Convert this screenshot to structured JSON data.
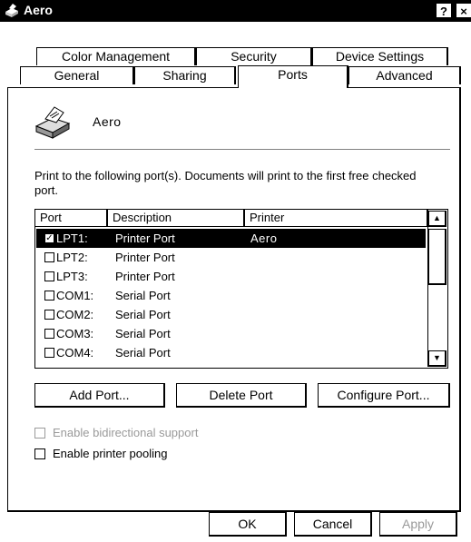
{
  "window": {
    "title": "Aero",
    "help_label": "?",
    "close_label": "×"
  },
  "tabs": {
    "row1": [
      "Color Management",
      "Security",
      "Device Settings"
    ],
    "row2": [
      "General",
      "Sharing",
      "Ports",
      "Advanced"
    ],
    "active": "Ports"
  },
  "printer": {
    "name": "Aero"
  },
  "description": "Print to the following port(s). Documents will print to the first free checked port.",
  "ports_list": {
    "columns": [
      "Port",
      "Description",
      "Printer"
    ],
    "rows": [
      {
        "checked": true,
        "port": "LPT1:",
        "description": "Printer Port",
        "printer": "Aero",
        "selected": true
      },
      {
        "checked": false,
        "port": "LPT2:",
        "description": "Printer Port",
        "printer": ""
      },
      {
        "checked": false,
        "port": "LPT3:",
        "description": "Printer Port",
        "printer": ""
      },
      {
        "checked": false,
        "port": "COM1:",
        "description": "Serial Port",
        "printer": ""
      },
      {
        "checked": false,
        "port": "COM2:",
        "description": "Serial Port",
        "printer": ""
      },
      {
        "checked": false,
        "port": "COM3:",
        "description": "Serial Port",
        "printer": ""
      },
      {
        "checked": false,
        "port": "COM4:",
        "description": "Serial Port",
        "printer": ""
      }
    ]
  },
  "port_buttons": {
    "add": "Add Port...",
    "delete": "Delete Port",
    "configure": "Configure Port..."
  },
  "options": {
    "bidirectional": {
      "label": "Enable bidirectional support",
      "checked": false,
      "enabled": false
    },
    "pooling": {
      "label": "Enable printer pooling",
      "checked": false,
      "enabled": true
    }
  },
  "dialog_buttons": {
    "ok": "OK",
    "cancel": "Cancel",
    "apply": "Apply"
  }
}
